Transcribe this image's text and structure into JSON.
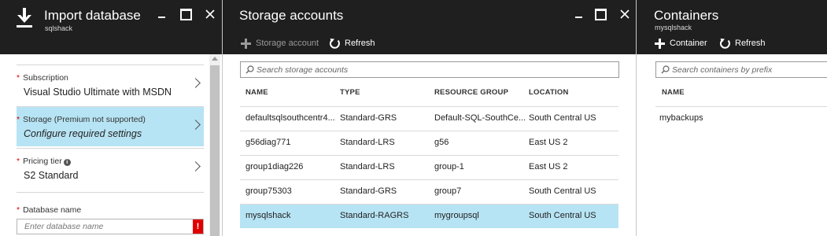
{
  "import_blade": {
    "title": "Import database",
    "subtitle": "sqlshack",
    "fields": [
      {
        "label": "Subscription",
        "required": "*",
        "value": "Visual Studio Ultimate with MSDN"
      },
      {
        "label": "Storage (Premium not supported)",
        "required": "*",
        "value": "Configure required settings"
      },
      {
        "label": "Pricing tier",
        "required": "*",
        "value": "S2 Standard"
      }
    ],
    "database_name": {
      "label": "Database name",
      "required": "*",
      "placeholder": "Enter database name",
      "error_badge": "!"
    }
  },
  "storage_blade": {
    "title": "Storage accounts",
    "toolbar": {
      "add_label": "Storage account",
      "refresh_label": "Refresh"
    },
    "search_placeholder": "Search storage accounts",
    "columns": [
      "NAME",
      "TYPE",
      "RESOURCE GROUP",
      "LOCATION"
    ],
    "rows": [
      [
        "defaultsqlsouthcentr4...",
        "Standard-GRS",
        "Default-SQL-SouthCe...",
        "South Central US"
      ],
      [
        "g56diag771",
        "Standard-LRS",
        "g56",
        "East US 2"
      ],
      [
        "group1diag226",
        "Standard-LRS",
        "group-1",
        "East US 2"
      ],
      [
        "group75303",
        "Standard-GRS",
        "group7",
        "South Central US"
      ],
      [
        "mysqlshack",
        "Standard-RAGRS",
        "mygroupsql",
        "South Central US"
      ]
    ],
    "selected_row": "mysqlshack"
  },
  "containers_blade": {
    "title": "Containers",
    "subtitle": "mysqlshack",
    "toolbar": {
      "add_label": "Container",
      "refresh_label": "Refresh"
    },
    "search_placeholder": "Search containers by prefix",
    "columns": [
      "NAME"
    ],
    "rows": [
      [
        "mybackups"
      ]
    ]
  },
  "colors": {
    "header_bg": "#1f1f1f",
    "selected_bg": "#b7e4f4",
    "required": "#e00000",
    "error": "#e00000"
  },
  "icons": {
    "import_blade": "download-icon",
    "window": [
      "minimize-icon",
      "maximize-icon",
      "close-icon"
    ],
    "toolbar": [
      "plus-icon",
      "refresh-icon"
    ],
    "search": "search-icon",
    "navigation": "chevron-right-icon",
    "info": "info-icon"
  }
}
